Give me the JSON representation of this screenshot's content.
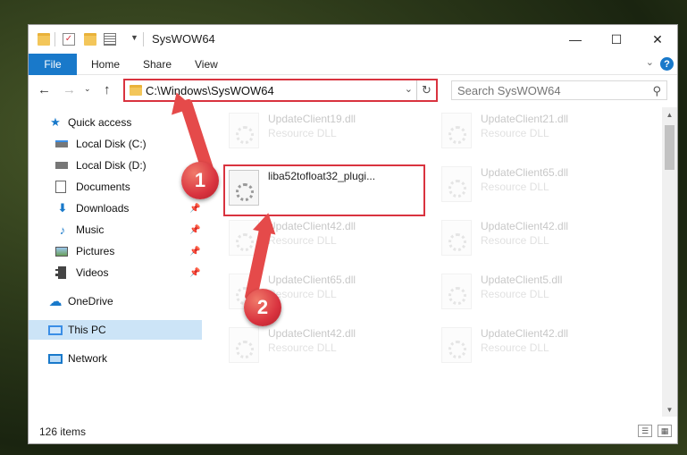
{
  "window": {
    "title": "SysWOW64",
    "controls": {
      "minimize": "—",
      "maximize": "☐",
      "close": "✕"
    }
  },
  "ribbon": {
    "file": "File",
    "tabs": [
      "Home",
      "Share",
      "View"
    ],
    "help": "?"
  },
  "address": {
    "path": "C:\\Windows\\SysWOW64",
    "search_placeholder": "Search SysWOW64"
  },
  "sidebar": {
    "items": [
      {
        "label": "Quick access",
        "icon": "star-icon"
      },
      {
        "label": "Local Disk (C:)",
        "icon": "drive-icon"
      },
      {
        "label": "Local Disk (D:)",
        "icon": "drive-icon"
      },
      {
        "label": "Documents",
        "icon": "documents-icon",
        "pinned": true
      },
      {
        "label": "Downloads",
        "icon": "downloads-icon",
        "pinned": true
      },
      {
        "label": "Music",
        "icon": "music-icon",
        "pinned": true
      },
      {
        "label": "Pictures",
        "icon": "pictures-icon",
        "pinned": true
      },
      {
        "label": "Videos",
        "icon": "videos-icon",
        "pinned": true
      },
      {
        "label": "OneDrive",
        "icon": "cloud-icon"
      },
      {
        "label": "This PC",
        "icon": "computer-icon",
        "selected": true
      },
      {
        "label": "Network",
        "icon": "network-icon"
      }
    ]
  },
  "files": [
    {
      "name": "UpdateClient19.dll",
      "type": "Resource DLL"
    },
    {
      "name": "UpdateClient21.dll",
      "type": "Resource DLL"
    },
    {
      "name": "liba52tofloat32_plugi...",
      "type": ""
    },
    {
      "name": "UpdateClient65.dll",
      "type": "Resource DLL"
    },
    {
      "name": "UpdateClient42.dll",
      "type": "Resource DLL"
    },
    {
      "name": "UpdateClient42.dll",
      "type": "Resource DLL"
    },
    {
      "name": "UpdateClient65.dll",
      "type": "Resource DLL"
    },
    {
      "name": "UpdateClient5.dll",
      "type": "Resource DLL"
    },
    {
      "name": "UpdateClient42.dll",
      "type": "Resource DLL"
    },
    {
      "name": "UpdateClient42.dll",
      "type": "Resource DLL"
    }
  ],
  "status": {
    "count": "126 items"
  },
  "annotations": {
    "step1": "1",
    "step2": "2"
  },
  "colors": {
    "accent": "#1979ca",
    "highlight": "#d9333f",
    "selected": "#cce4f7"
  }
}
